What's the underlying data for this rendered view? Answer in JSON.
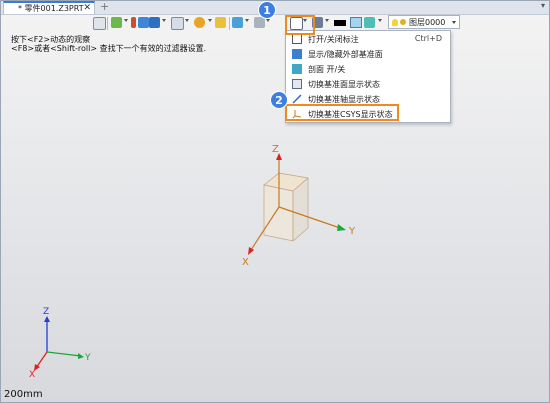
{
  "tab": {
    "title": "* 零件001.Z3PRT",
    "close_label": "✕",
    "add_label": "+",
    "menu_label": "▾"
  },
  "toolbar": {
    "layer_label": "图层0000"
  },
  "hints": {
    "line1": "按下<F2>动态的观察",
    "line2": "<F8>或者<Shift-roll> 查找下一个有效的过滤器设置."
  },
  "badges": {
    "one": "1",
    "two": "2"
  },
  "menu": {
    "items": [
      {
        "label": "打开/关闭标注",
        "shortcut": "Ctrl+D"
      },
      {
        "label": "显示/隐藏外部基准面"
      },
      {
        "label": "剖面 开/关"
      },
      {
        "label": "切换基准面显示状态"
      },
      {
        "label": "切换基准轴显示状态"
      },
      {
        "label": "切换基准CSYS显示状态"
      }
    ]
  },
  "axes": {
    "main": {
      "z": "Z",
      "y": "Y",
      "x": "X"
    },
    "corner": {
      "z": "Z",
      "y": "Y",
      "x": "X"
    }
  },
  "colors": {
    "highlight": "#f08a1c",
    "badge": "#3d7fe0",
    "axis_x": "#e02020",
    "axis_y": "#1aa83a",
    "axis_z": "#1f3fd6",
    "datum_axis": "#c87a1e"
  },
  "scale": "200mm"
}
